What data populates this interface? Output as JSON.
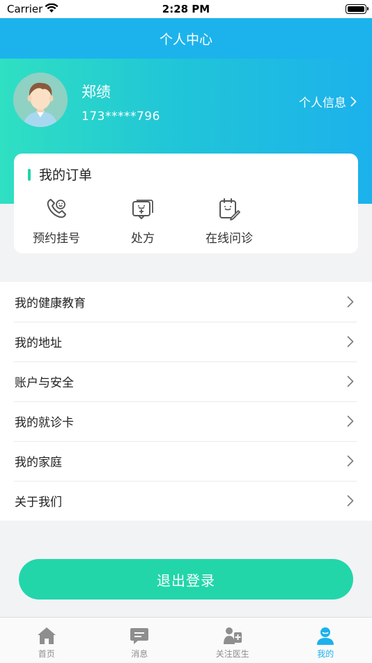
{
  "status_bar": {
    "carrier": "Carrier",
    "time": "2:28 PM"
  },
  "nav": {
    "title": "个人中心"
  },
  "profile": {
    "name": "郑绩",
    "phone": "173*****796",
    "info_link": "个人信息"
  },
  "orders": {
    "title": "我的订单",
    "items": [
      {
        "label": "预约挂号",
        "icon": "phone-appointment-icon"
      },
      {
        "label": "处方",
        "icon": "prescription-icon"
      },
      {
        "label": "在线问诊",
        "icon": "online-consultation-icon"
      }
    ]
  },
  "menu": {
    "items": [
      {
        "label": "我的健康教育"
      },
      {
        "label": "我的地址"
      },
      {
        "label": "账户与安全"
      },
      {
        "label": "我的就诊卡"
      },
      {
        "label": "我的家庭"
      },
      {
        "label": "关于我们"
      }
    ]
  },
  "logout": {
    "label": "退出登录"
  },
  "tabs": {
    "items": [
      {
        "label": "首页",
        "icon": "home-icon"
      },
      {
        "label": "消息",
        "icon": "message-icon"
      },
      {
        "label": "关注医生",
        "icon": "doctor-icon"
      },
      {
        "label": "我的",
        "icon": "profile-icon"
      }
    ],
    "active_index": 3
  },
  "colors": {
    "primary_blue": "#1cb3ec",
    "accent_green": "#22d6aa",
    "gradient_start": "#2fe0c2"
  }
}
